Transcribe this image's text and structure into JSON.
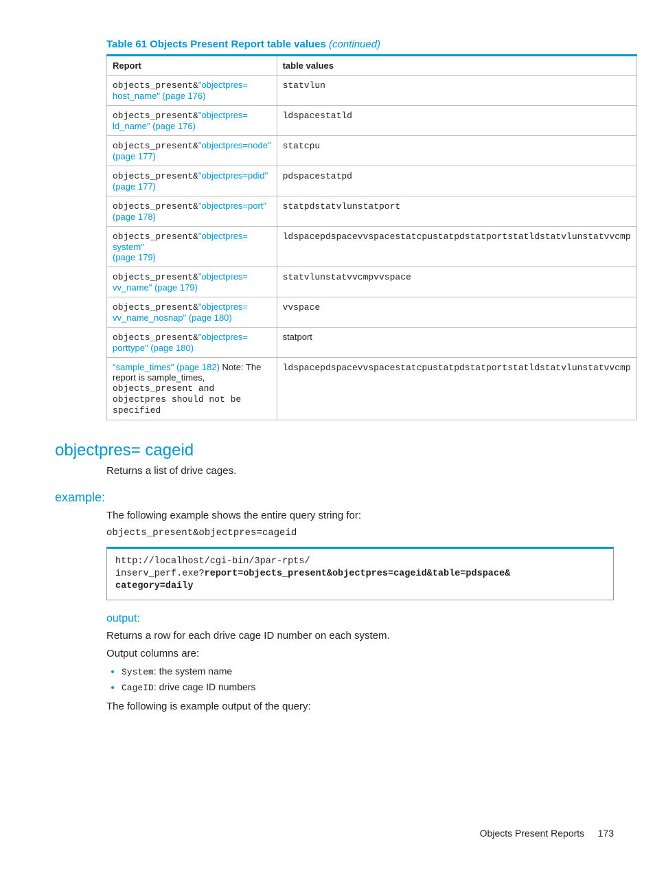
{
  "caption": {
    "main": "Table 61 Objects Present Report table values",
    "continued": "(continued)"
  },
  "headers": {
    "report": "Report",
    "values": "table values"
  },
  "rows": [
    {
      "prefix": "objects_present&",
      "link_head": "\"objectpres=",
      "link_tail": "host_name\" (page 176)",
      "single": false,
      "note": "",
      "value": "statvlun"
    },
    {
      "prefix": "objects_present&",
      "link_head": "\"objectpres=",
      "link_tail": "ld_name\" (page 176)",
      "single": false,
      "note": "",
      "value": "ldspacestatld"
    },
    {
      "prefix": "objects_present&",
      "link_head": "\"objectpres=node\"",
      "link_tail": "(page 177)",
      "single": false,
      "note": "",
      "value": "statcpu"
    },
    {
      "prefix": "objects_present&",
      "link_head": "\"objectpres=pdid\"",
      "link_tail": "(page 177)",
      "single": false,
      "note": "",
      "value": "pdspacestatpd"
    },
    {
      "prefix": "objects_present&",
      "link_head": "\"objectpres=port\"",
      "link_tail": "(page 178)",
      "single": false,
      "note": "",
      "value": "statpdstatvlunstatport"
    },
    {
      "prefix": "objects_present&",
      "link_head": "\"objectpres= system\"",
      "link_tail": "(page 179)",
      "single": false,
      "note": "",
      "value": "ldspacepdspacevvspacestatcpustatpdstatportstatldstatvlunstatvvcmp"
    },
    {
      "prefix": "objects_present&",
      "link_head": "\"objectpres=",
      "link_tail": "vv_name\" (page 179)",
      "single": false,
      "note": "",
      "value": "statvlunstatvvcmpvvspace"
    },
    {
      "prefix": "objects_present&",
      "link_head": "\"objectpres=",
      "link_tail": "vv_name_nosnap\" (page 180)",
      "single": false,
      "note": "",
      "value": "vvspace"
    },
    {
      "prefix": "objects_present&",
      "link_head": "\"objectpres=",
      "link_tail": "porttype\" (page 180)",
      "single": false,
      "note": "",
      "value": "statport"
    },
    {
      "prefix": "",
      "link_head": "\"sample_times\" (page 182)",
      "link_tail": "",
      "single": true,
      "note_prefix": " Note: The report is sample_times, ",
      "note_mono": "objects_present and objectpres should not be specified",
      "value": "ldspacepdspacevvspacestatcpustatpdstatportstatldstatvlunstatvvcmp"
    }
  ],
  "section": {
    "heading": "objectpres= cageid",
    "intro": "Returns a list of drive cages."
  },
  "example": {
    "heading": "example:",
    "lead": "The following example shows the entire query string for:",
    "query": "objects_present&objectpres=cageid",
    "code_line1": "http://localhost/cgi-bin/3par-rpts/",
    "code_line2a": "inserv_perf.exe?",
    "code_line2b": "report=objects_present&objectpres=cageid&table=pdspace&",
    "code_line3": "category=daily"
  },
  "output": {
    "heading": "output:",
    "desc1": "Returns a row for each drive cage ID number on each system.",
    "desc2": "Output columns are:",
    "items": [
      {
        "code": "System",
        "text": ": the system name"
      },
      {
        "code": "CageID",
        "text": ": drive cage ID numbers"
      }
    ],
    "closing": "The following is example output of the query:"
  },
  "footer": {
    "section": "Objects Present Reports",
    "page": "173"
  }
}
